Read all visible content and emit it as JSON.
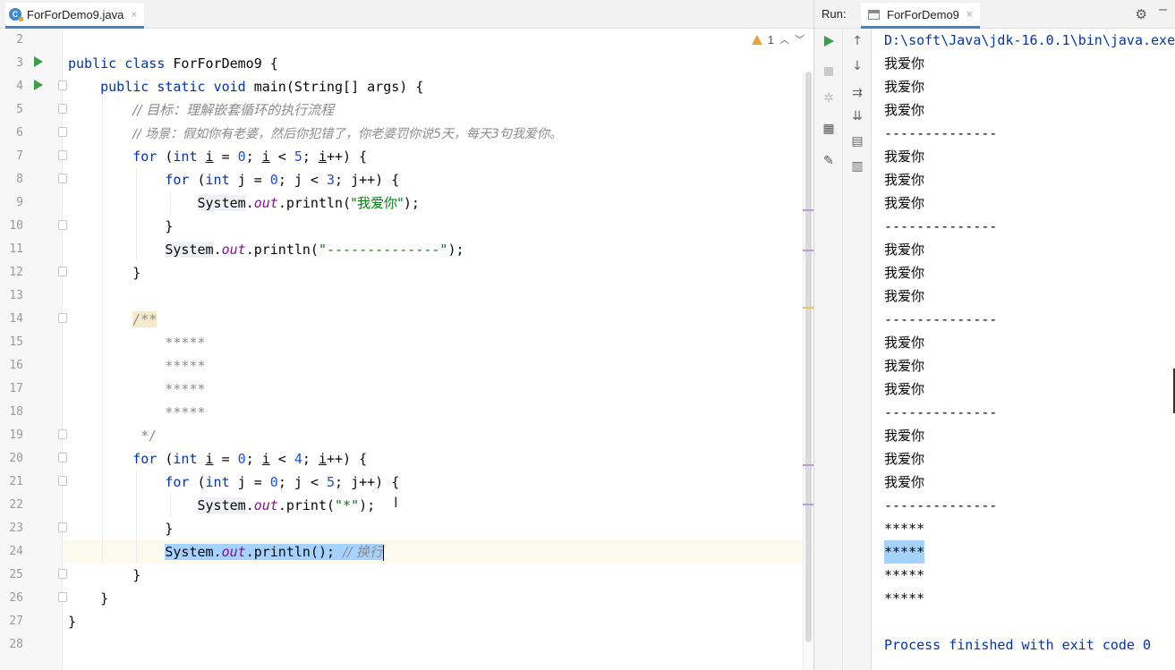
{
  "editor": {
    "tab": {
      "filename": "ForForDemo9.java",
      "close_glyph": "×",
      "icon_letter": "C"
    },
    "inspection": {
      "count": "1",
      "up": "︿",
      "down": "﹀"
    },
    "line_numbers": [
      "2",
      "3",
      "4",
      "5",
      "6",
      "7",
      "8",
      "9",
      "10",
      "11",
      "12",
      "13",
      "14",
      "15",
      "16",
      "17",
      "18",
      "19",
      "20",
      "21",
      "22",
      "23",
      "24",
      "25",
      "26",
      "27",
      "28"
    ],
    "code": {
      "l3": {
        "kw1": "public",
        "kw2": "class",
        "rest": " ForForDemo9 {"
      },
      "l4": {
        "kw1": "public",
        "kw2": "static",
        "kw3": "void",
        "rest": " main(String[] args) {"
      },
      "l5": "// 目标：理解嵌套循环的执行流程",
      "l6": "// 场景：假如你有老婆，然后你犯错了，你老婆罚你说5天，每天3句我爱你。",
      "l7": {
        "for": "for",
        "p1": " (",
        "int": "int",
        "sp": " ",
        "var1": "i",
        "eq": " = ",
        "n0": "0",
        "semi1": "; ",
        "var2": "i",
        "lt": " < ",
        "n5": "5",
        "semi2": "; ",
        "var3": "i",
        "end": "++) {"
      },
      "l8": {
        "for": "for",
        "p1": " (",
        "int": "int",
        "mid": " j = ",
        "n0": "0",
        "lt": "; j < ",
        "n3": "3",
        "end": "; j++) {"
      },
      "l9": {
        "system": "System",
        "dot": ".",
        "out": "out",
        "call": ".println(",
        "str": "\"我爱你\"",
        "end": ");"
      },
      "l10": "}",
      "l11": {
        "system": "System",
        "dot": ".",
        "out": "out",
        "call": ".println(",
        "str": "\"--------------\"",
        "end": ");"
      },
      "l12": "}",
      "l14": "/**",
      "l15": "*****",
      "l16": "*****",
      "l17": "*****",
      "l18": "*****",
      "l19": "*/",
      "l20": {
        "for": "for",
        "p1": " (",
        "int": "int",
        "sp": " ",
        "var1": "i",
        "eq": " = ",
        "n0": "0",
        "semi1": "; ",
        "var2": "i",
        "lt": " < ",
        "n4": "4",
        "semi2": "; ",
        "var3": "i",
        "end": "++) {"
      },
      "l21": {
        "for": "for",
        "p1": " (",
        "int": "int",
        "mid": " j = ",
        "n0": "0",
        "lt": "; j < ",
        "n5": "5",
        "end": "; j++) {"
      },
      "l22": {
        "system": "System",
        "dot": ".",
        "out": "out",
        "call": ".print(",
        "str": "\"*\"",
        "end": ");"
      },
      "l23": "}",
      "l24": {
        "system": "System",
        "dot": ".",
        "out": "out",
        "call": ".println(); ",
        "cmt": "// 换行"
      },
      "l25": "}",
      "l26": "}",
      "l27": "}"
    }
  },
  "run": {
    "label": "Run:",
    "tab": {
      "name": "ForForDemo9",
      "close_glyph": "×"
    },
    "output": {
      "command": "D:\\soft\\Java\\jdk-16.0.1\\bin\\java.exe",
      "lines": [
        "我爱你",
        "我爱你",
        "我爱你",
        "--------------",
        "我爱你",
        "我爱你",
        "我爱你",
        "--------------",
        "我爱你",
        "我爱你",
        "我爱你",
        "--------------",
        "我爱你",
        "我爱你",
        "我爱你",
        "--------------",
        "我爱你",
        "我爱你",
        "我爱你",
        "--------------",
        "*****",
        "*****",
        "*****",
        "*****"
      ],
      "exit": "Process finished with exit code 0"
    },
    "toolbar_icons": [
      "rerun-icon",
      "stop-icon",
      "debug-icon",
      "layout-icon",
      "pin-icon",
      "up-arrow-icon",
      "down-arrow-icon",
      "soft-wrap-icon",
      "scroll-to-end-icon",
      "print-icon",
      "trash-icon"
    ]
  },
  "colors": {
    "keyword": "#0033b3",
    "number": "#1750eb",
    "string": "#067d17",
    "field": "#871094",
    "comment": "#8c8c8c",
    "selection": "#a6d2ff",
    "run_green": "#3a9d4a",
    "tab_underline": "#4083c9"
  }
}
